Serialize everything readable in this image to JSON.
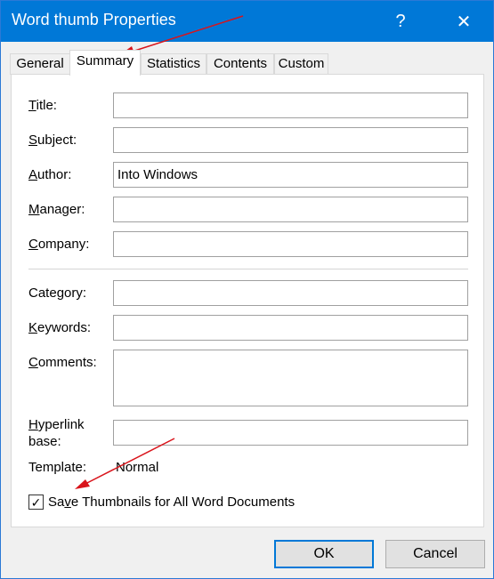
{
  "window": {
    "title": "Word thumb Properties"
  },
  "titlebar": {
    "help_glyph": "?",
    "close_glyph": "✕"
  },
  "tabs": [
    {
      "label": "General",
      "active": false
    },
    {
      "label": "Summary",
      "active": true
    },
    {
      "label": "Statistics",
      "active": false
    },
    {
      "label": "Contents",
      "active": false
    },
    {
      "label": "Custom",
      "active": false
    }
  ],
  "fields": {
    "title": {
      "label": "Title:",
      "value": ""
    },
    "subject": {
      "label": "Subject:",
      "value": ""
    },
    "author": {
      "label": "Author:",
      "value": "Into Windows"
    },
    "manager": {
      "label": "Manager:",
      "value": ""
    },
    "company": {
      "label": "Company:",
      "value": ""
    },
    "category": {
      "label": "Category:",
      "value": ""
    },
    "keywords": {
      "label": "Keywords:",
      "value": ""
    },
    "comments": {
      "label": "Comments:",
      "value": ""
    },
    "hyperlink_base": {
      "label_line1": "Hyperlink",
      "label_line2": "base:",
      "value": ""
    },
    "template": {
      "label": "Template:",
      "value": "Normal"
    }
  },
  "save_thumbnails": {
    "label": "Save Thumbnails for All Word Documents",
    "checked": true,
    "check_glyph": "✓"
  },
  "buttons": {
    "ok": "OK",
    "cancel": "Cancel"
  },
  "colors": {
    "titlebar": "#0078d7",
    "annotation_arrow": "#d9141b"
  }
}
